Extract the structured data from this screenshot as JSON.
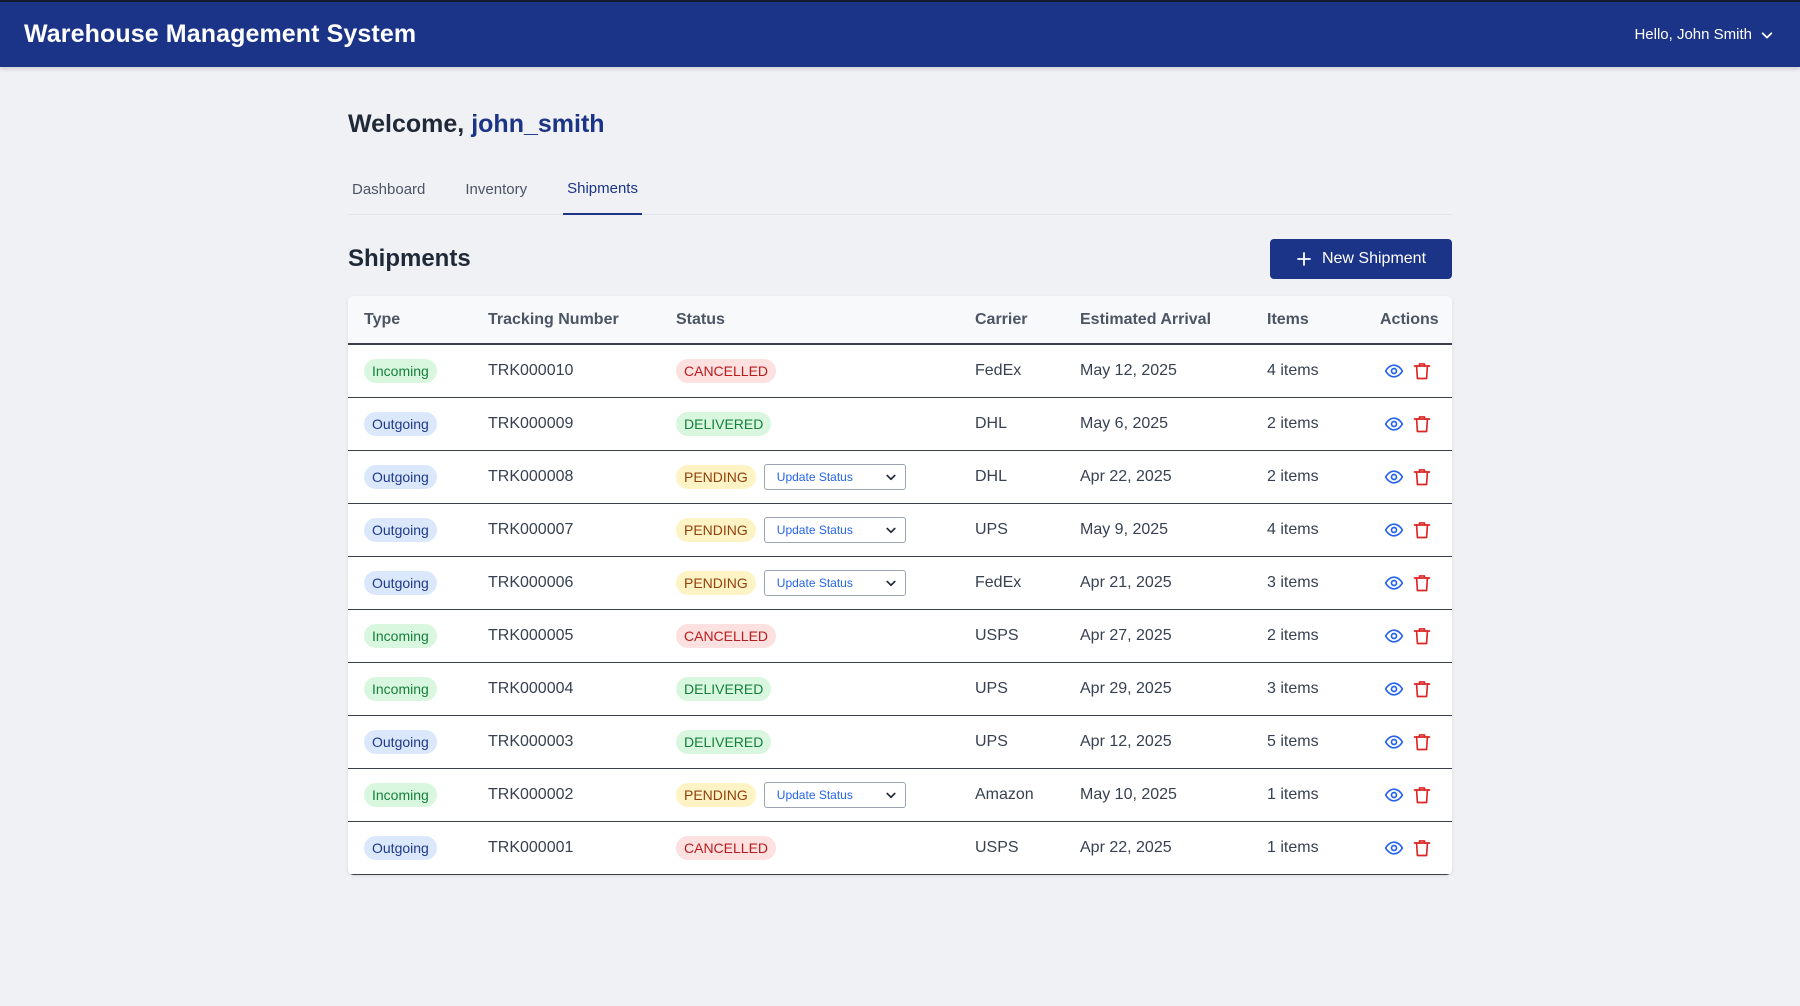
{
  "header": {
    "title": "Warehouse Management System",
    "user_greeting": "Hello, John Smith"
  },
  "welcome": {
    "prefix": "Welcome,",
    "username": "john_smith"
  },
  "tabs": [
    {
      "label": "Dashboard"
    },
    {
      "label": "Inventory"
    },
    {
      "label": "Shipments",
      "active": true
    }
  ],
  "section": {
    "title": "Shipments",
    "new_button_label": "New Shipment"
  },
  "table": {
    "columns": [
      "Type",
      "Tracking Number",
      "Status",
      "Carrier",
      "Estimated Arrival",
      "Items",
      "Actions"
    ],
    "update_status_label": "Update Status",
    "rows": [
      {
        "type": "Incoming",
        "tracking": "TRK000010",
        "status": "CANCELLED",
        "carrier": "FedEx",
        "eta": "May 12, 2025",
        "items": "4 items"
      },
      {
        "type": "Outgoing",
        "tracking": "TRK000009",
        "status": "DELIVERED",
        "carrier": "DHL",
        "eta": "May 6, 2025",
        "items": "2 items"
      },
      {
        "type": "Outgoing",
        "tracking": "TRK000008",
        "status": "PENDING",
        "carrier": "DHL",
        "eta": "Apr 22, 2025",
        "items": "2 items"
      },
      {
        "type": "Outgoing",
        "tracking": "TRK000007",
        "status": "PENDING",
        "carrier": "UPS",
        "eta": "May 9, 2025",
        "items": "4 items"
      },
      {
        "type": "Outgoing",
        "tracking": "TRK000006",
        "status": "PENDING",
        "carrier": "FedEx",
        "eta": "Apr 21, 2025",
        "items": "3 items"
      },
      {
        "type": "Incoming",
        "tracking": "TRK000005",
        "status": "CANCELLED",
        "carrier": "USPS",
        "eta": "Apr 27, 2025",
        "items": "2 items"
      },
      {
        "type": "Incoming",
        "tracking": "TRK000004",
        "status": "DELIVERED",
        "carrier": "UPS",
        "eta": "Apr 29, 2025",
        "items": "3 items"
      },
      {
        "type": "Outgoing",
        "tracking": "TRK000003",
        "status": "DELIVERED",
        "carrier": "UPS",
        "eta": "Apr 12, 2025",
        "items": "5 items"
      },
      {
        "type": "Incoming",
        "tracking": "TRK000002",
        "status": "PENDING",
        "carrier": "Amazon",
        "eta": "May 10, 2025",
        "items": "1 items"
      },
      {
        "type": "Outgoing",
        "tracking": "TRK000001",
        "status": "CANCELLED",
        "carrier": "USPS",
        "eta": "Apr 22, 2025",
        "items": "1 items"
      }
    ]
  },
  "colors": {
    "brand": "#1b3487",
    "view_icon": "#2563eb",
    "delete_icon": "#dc2626"
  },
  "icons": {
    "user_menu": "chevron-down-icon",
    "new_button": "plus-icon",
    "view": "eye-icon",
    "delete": "trash-icon"
  }
}
